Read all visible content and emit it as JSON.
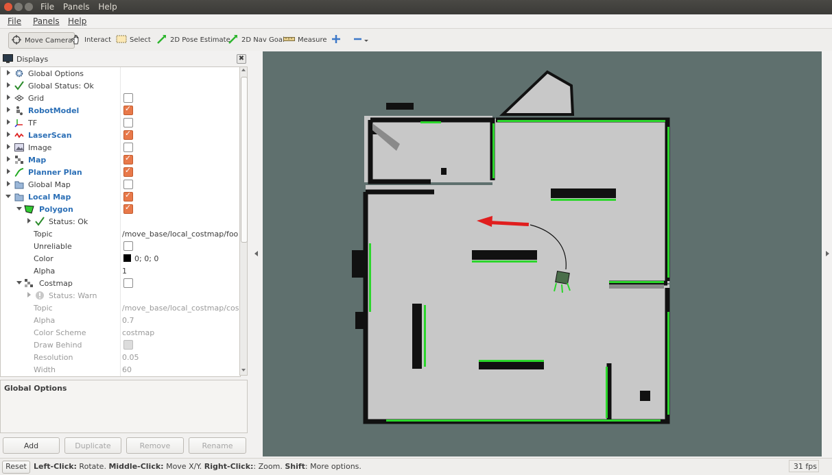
{
  "window": {
    "title_menu": [
      "File",
      "Panels",
      "Help"
    ]
  },
  "menubar": {
    "file": "File",
    "panels": "Panels",
    "help": "Help"
  },
  "toolbar": {
    "move_camera": "Move Camera",
    "interact": "Interact",
    "select": "Select",
    "pose_estimate": "2D Pose Estimate",
    "nav_goal": "2D Nav Goal",
    "measure": "Measure"
  },
  "displays": {
    "title": "Displays",
    "rows": [
      {
        "label": "Global Options"
      },
      {
        "label": "Global Status: Ok"
      },
      {
        "label": "Grid"
      },
      {
        "label": "RobotModel"
      },
      {
        "label": "TF"
      },
      {
        "label": "LaserScan"
      },
      {
        "label": "Image"
      },
      {
        "label": "Map"
      },
      {
        "label": "Planner Plan"
      },
      {
        "label": "Global Map"
      },
      {
        "label": "Local Map"
      },
      {
        "label": "Polygon"
      },
      {
        "label": "Status: Ok"
      },
      {
        "label": "Topic",
        "value": "/move_base/local_costmap/foo..."
      },
      {
        "label": "Unreliable"
      },
      {
        "label": "Color",
        "value": "0; 0; 0"
      },
      {
        "label": "Alpha",
        "value": "1"
      },
      {
        "label": "Costmap"
      },
      {
        "label": "Status: Warn"
      },
      {
        "label": "Topic",
        "value": "/move_base/local_costmap/cos..."
      },
      {
        "label": "Alpha",
        "value": "0.7"
      },
      {
        "label": "Color Scheme",
        "value": "costmap"
      },
      {
        "label": "Draw Behind"
      },
      {
        "label": "Resolution",
        "value": "0.05"
      },
      {
        "label": "Width",
        "value": "60"
      }
    ]
  },
  "description": {
    "title": "Global Options"
  },
  "buttons": {
    "add": "Add",
    "duplicate": "Duplicate",
    "remove": "Remove",
    "rename": "Rename"
  },
  "status": {
    "reset": "Reset",
    "left_click": "Left-Click:",
    "left_text": " Rotate. ",
    "middle_click": "Middle-Click:",
    "middle_text": " Move X/Y. ",
    "right_click": "Right-Click:",
    "right_text": ": Zoom. ",
    "shift": "Shift",
    "shift_text": ": More options.",
    "fps": "31 fps"
  },
  "colors": {
    "checkbox_on": "#e8794a",
    "viewport_bg": "#5f706e",
    "map_free": "#c8c8c8",
    "wall": "#111111",
    "laser": "#2bd62b",
    "goal_arrow": "#e01e1e",
    "link_blue": "#2b6fb6"
  }
}
